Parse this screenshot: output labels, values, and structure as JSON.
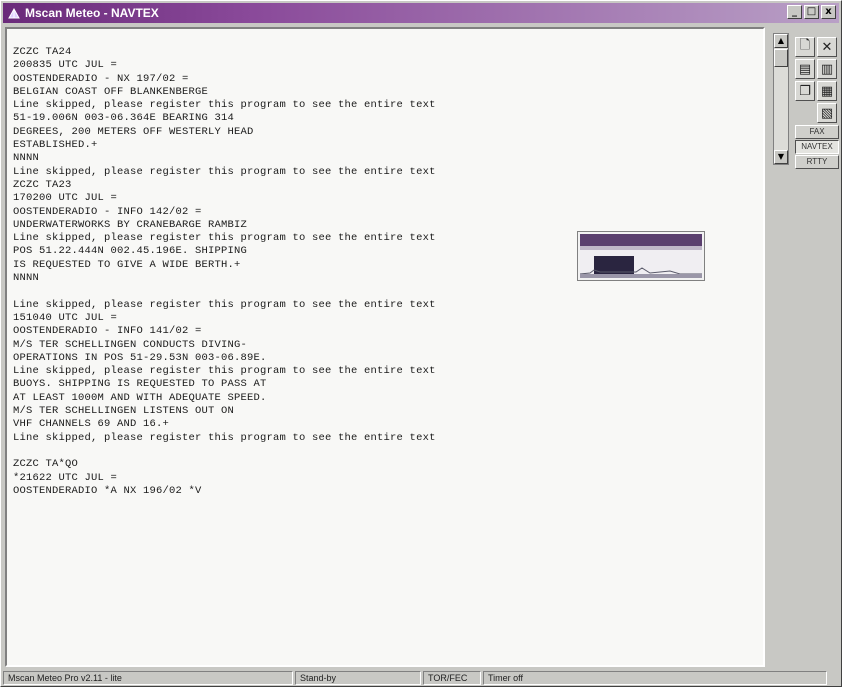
{
  "window": {
    "title": "Mscan Meteo - NAVTEX"
  },
  "title_buttons": {
    "minimize": "_",
    "maximize": "□",
    "close": "x"
  },
  "message_lines": [
    "ZCZC TA24",
    "200835 UTC JUL =",
    "OOSTENDERADIO - NX 197/02 =",
    "BELGIAN COAST OFF BLANKENBERGE",
    "Line skipped, please register this program to see the entire text",
    "51-19.006N 003-06.364E BEARING 314",
    "DEGREES, 200 METERS OFF WESTERLY HEAD",
    "ESTABLISHED.+",
    "NNNN",
    "Line skipped, please register this program to see the entire text",
    "ZCZC TA23",
    "170200 UTC JUL =",
    "OOSTENDERADIO - INFO 142/02 =",
    "UNDERWATERWORKS BY CRANEBARGE RAMBIZ",
    "Line skipped, please register this program to see the entire text",
    "POS 51.22.444N 002.45.196E. SHIPPING",
    "IS REQUESTED TO GIVE A WIDE BERTH.+",
    "NNNN",
    "",
    "Line skipped, please register this program to see the entire text",
    "151040 UTC JUL =",
    "OOSTENDERADIO - INFO 141/02 =",
    "M/S TER SCHELLINGEN CONDUCTS DIVING-",
    "OPERATIONS IN POS 51-29.53N 003-06.89E.",
    "Line skipped, please register this program to see the entire text",
    "BUOYS. SHIPPING IS REQUESTED TO PASS AT",
    "AT LEAST 1000M AND WITH ADEQUATE SPEED.",
    "M/S TER SCHELLINGEN LISTENS OUT ON",
    "VHF CHANNELS 69 AND 16.+",
    "Line skipped, please register this program to see the entire text",
    "",
    "ZCZC TA*QO",
    "*21622 UTC JUL =",
    "OOSTENDERADIO *A NX 196/02 *V"
  ],
  "modes": {
    "fax": "FAX",
    "navtex": "NAVTEX",
    "rtty": "RTTY",
    "active": "NAVTEX"
  },
  "status": {
    "app_version": "Mscan Meteo Pro v2.11 - lite",
    "state": "Stand-by",
    "mode": "TOR/FEC",
    "timer": "Timer off"
  },
  "colors": {
    "titlebar": "#6a2a7a",
    "background": "#c8c8c4",
    "text": "#1a1a1a"
  }
}
